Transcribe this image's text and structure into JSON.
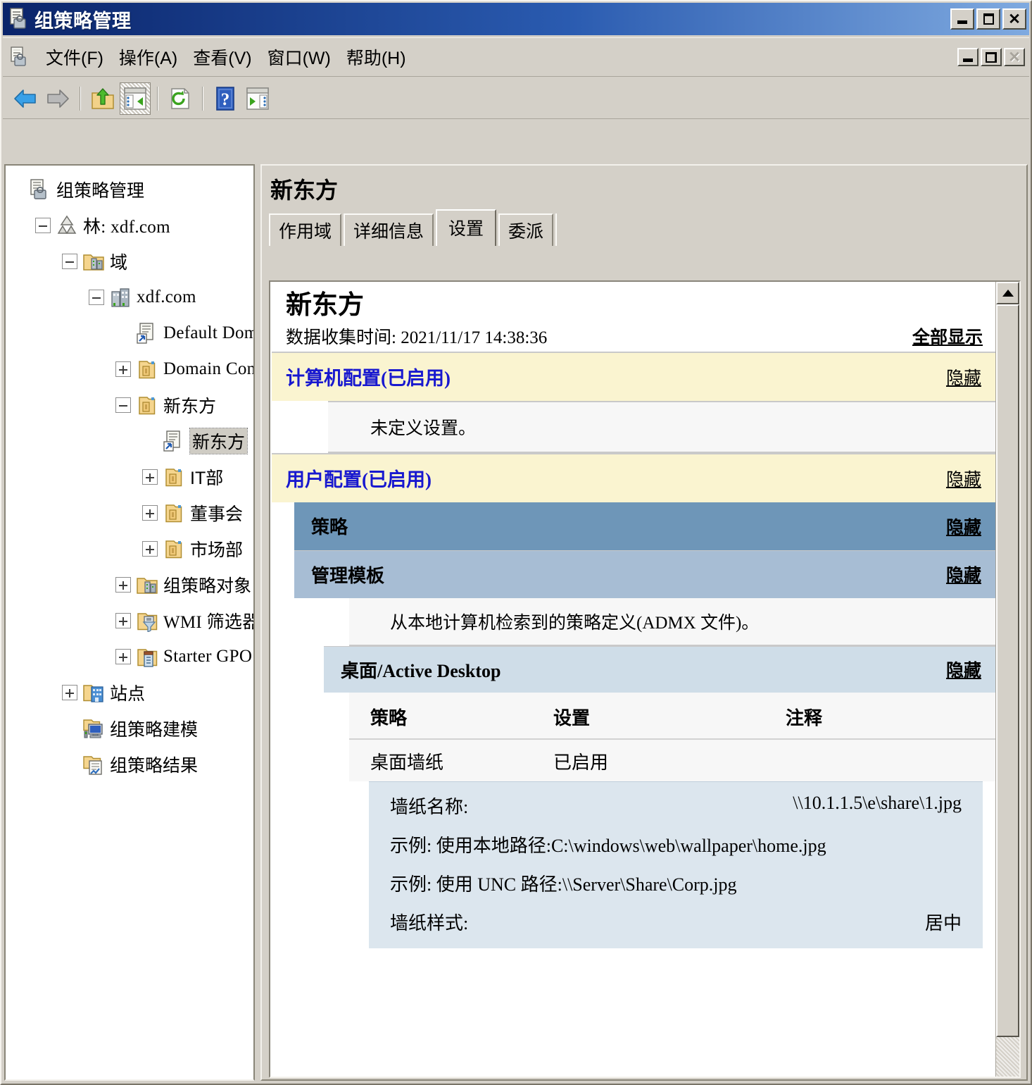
{
  "window": {
    "title": "组策略管理",
    "icon": "gpmc-icon",
    "buttons": {
      "minimize": "最小化",
      "maximize": "最大化",
      "close": "关闭"
    }
  },
  "menubar": {
    "icon": "gpmc-small-icon",
    "items": [
      {
        "label": "文件(F)",
        "name": "menu-file"
      },
      {
        "label": "操作(A)",
        "name": "menu-action"
      },
      {
        "label": "查看(V)",
        "name": "menu-view"
      },
      {
        "label": "窗口(W)",
        "name": "menu-window"
      },
      {
        "label": "帮助(H)",
        "name": "menu-help"
      }
    ],
    "child_buttons": {
      "minimize": "最小化",
      "restore": "还原",
      "close": "关闭"
    }
  },
  "toolbar": {
    "buttons": [
      {
        "name": "back-icon",
        "title": "后退"
      },
      {
        "name": "forward-icon",
        "title": "前进"
      },
      {
        "name": "up-folder-icon",
        "title": "上一级"
      },
      {
        "name": "show-hide-tree-icon",
        "title": "显示/隐藏控制台树",
        "pressed": true
      },
      {
        "name": "refresh-icon",
        "title": "刷新"
      },
      {
        "name": "help-icon",
        "title": "帮助"
      },
      {
        "name": "show-hide-action-pane-icon",
        "title": "显示/隐藏操作窗格"
      }
    ]
  },
  "tree": {
    "nodes": [
      {
        "label": "组策略管理",
        "indent": 0,
        "plug": "none",
        "icon": "gpmc-root-icon",
        "selected": false,
        "mono": false
      },
      {
        "label": "林: xdf.com",
        "indent": 1,
        "plug": "minus",
        "icon": "forest-icon",
        "selected": false,
        "mono": true
      },
      {
        "label": "域",
        "indent": 2,
        "plug": "minus",
        "icon": "domains-folder-icon",
        "selected": false,
        "mono": false
      },
      {
        "label": "xdf.com",
        "indent": 3,
        "plug": "minus",
        "icon": "domain-icon",
        "selected": false,
        "mono": true
      },
      {
        "label": "Default Domain",
        "indent": 4,
        "plug": "none",
        "icon": "gpo-link-icon",
        "selected": false,
        "mono": true
      },
      {
        "label": "Domain Control",
        "indent": 4,
        "plug": "plus",
        "icon": "ou-icon",
        "selected": false,
        "mono": true
      },
      {
        "label": "新东方",
        "indent": 4,
        "plug": "minus",
        "icon": "ou-icon",
        "selected": false,
        "mono": false
      },
      {
        "label": "新东方",
        "indent": 5,
        "plug": "none",
        "icon": "gpo-link-icon",
        "selected": true,
        "mono": false
      },
      {
        "label": "IT部",
        "indent": 5,
        "plug": "plus",
        "icon": "ou-icon",
        "selected": false,
        "mono": false
      },
      {
        "label": "董事会",
        "indent": 5,
        "plug": "plus",
        "icon": "ou-icon",
        "selected": false,
        "mono": false
      },
      {
        "label": "市场部",
        "indent": 5,
        "plug": "plus",
        "icon": "ou-icon",
        "selected": false,
        "mono": false
      },
      {
        "label": "组策略对象",
        "indent": 4,
        "plug": "plus",
        "icon": "gpo-folder-icon",
        "selected": false,
        "mono": false
      },
      {
        "label": "WMI 筛选器",
        "indent": 4,
        "plug": "plus",
        "icon": "wmi-filter-icon",
        "selected": false,
        "mono": true
      },
      {
        "label": "Starter GPO",
        "indent": 4,
        "plug": "plus",
        "icon": "starter-gpo-icon",
        "selected": false,
        "mono": true
      },
      {
        "label": "站点",
        "indent": 2,
        "plug": "plus",
        "icon": "sites-icon",
        "selected": false,
        "mono": false
      },
      {
        "label": "组策略建模",
        "indent": 2,
        "plug": "none",
        "icon": "gp-modeling-icon",
        "selected": false,
        "mono": false
      },
      {
        "label": "组策略结果",
        "indent": 2,
        "plug": "none",
        "icon": "gp-results-icon",
        "selected": false,
        "mono": false
      }
    ]
  },
  "right_pane": {
    "title": "新东方",
    "tabs": [
      {
        "label": "作用域",
        "active": false
      },
      {
        "label": "详细信息",
        "active": false
      },
      {
        "label": "设置",
        "active": true
      },
      {
        "label": "委派",
        "active": false
      }
    ]
  },
  "report": {
    "heading": "新东方",
    "collected_label": "数据收集时间: 2021/11/17 14:38:36",
    "show_all_link": "全部显示",
    "hide_link": "隐藏",
    "sections": [
      {
        "name": "computer-configuration",
        "title": "计算机配置(已启用)",
        "note": "未定义设置。"
      },
      {
        "name": "user-configuration",
        "title": "用户配置(已启用)",
        "sub_policy": "策略",
        "sub_admin_templates": "管理模板",
        "admx_note": "从本地计算机检索到的策略定义(ADMX 文件)。",
        "group": "桌面/Active Desktop"
      }
    ],
    "table": {
      "headers": [
        "策略",
        "设置",
        "注释"
      ],
      "rows": [
        {
          "policy": "桌面墙纸",
          "setting": "已启用",
          "comment": ""
        }
      ],
      "details": [
        {
          "label": "墙纸名称:",
          "value": "\\\\10.1.1.5\\e\\share\\1.jpg",
          "layout": "split"
        },
        {
          "label": "示例: 使用本地路径:C:\\windows\\web\\wallpaper\\home.jpg",
          "value": "",
          "layout": "full"
        },
        {
          "label": "示例: 使用 UNC 路径:\\\\Server\\Share\\Corp.jpg",
          "value": "",
          "layout": "full"
        },
        {
          "label": "墙纸样式:",
          "value": "居中",
          "layout": "split"
        }
      ]
    }
  },
  "colors": {
    "titlebar_start": "#0a246a",
    "titlebar_end": "#7faae0",
    "chrome": "#d4d0c8",
    "section_yellow": "#faf4d0",
    "band_blue_dark": "#6e96b8",
    "band_blue_mid": "#a7bdd4",
    "band_blue_light": "#cfdde8",
    "detail_blue": "#dce6ee",
    "link_blue": "#1818cf"
  }
}
